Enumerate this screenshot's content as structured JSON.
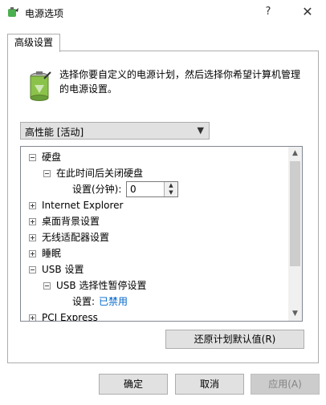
{
  "window": {
    "title": "电源选项",
    "help_glyph": "?",
    "close_glyph": "✕"
  },
  "tab": {
    "label": "高级设置"
  },
  "description": "选择你要自定义的电源计划，然后选择你希望计算机管理的电源设置。",
  "plan_select": {
    "value": "高性能 [活动]"
  },
  "tree": {
    "items": [
      {
        "label": "硬盘",
        "state": "expanded"
      },
      {
        "label": "在此时间后关闭硬盘",
        "state": "expanded"
      },
      {
        "label": "设置(分钟):",
        "value": "0"
      },
      {
        "label": "Internet Explorer",
        "state": "collapsed"
      },
      {
        "label": "桌面背景设置",
        "state": "collapsed"
      },
      {
        "label": "无线适配器设置",
        "state": "collapsed"
      },
      {
        "label": "睡眠",
        "state": "collapsed"
      },
      {
        "label": "USB 设置",
        "state": "expanded"
      },
      {
        "label": "USB 选择性暂停设置",
        "state": "expanded"
      },
      {
        "label": "设置:",
        "value": "已禁用"
      },
      {
        "label": "PCI Express",
        "state": "collapsed"
      }
    ]
  },
  "restore_button": "还原计划默认值(R)",
  "buttons": {
    "ok": "确定",
    "cancel": "取消",
    "apply": "应用(A)"
  },
  "colors": {
    "link_value": "#0066cc",
    "disabled_text": "#838383"
  }
}
